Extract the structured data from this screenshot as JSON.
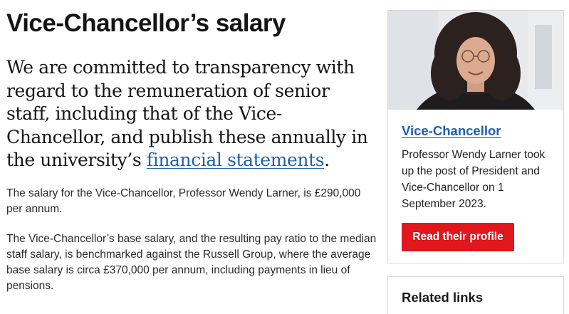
{
  "page": {
    "title": "Vice-Chancellor’s salary",
    "lede_before_link": "We are committed to transparency with regard to the remuneration of senior staff, including that of the Vice-Chancellor, and publish these annually in the university’s ",
    "lede_link": "financial statements",
    "lede_after_link": ".",
    "paragraph_1": "The salary for the Vice-Chancellor, Professor Wendy Larner, is £290,000 per annum.",
    "paragraph_2": "The Vice-Chancellor’s base salary, and the resulting pay ratio to the median staff salary, is benchmarked against the Russell Group, where the average base salary is circa £370,000 per annum, including payments in lieu of pensions."
  },
  "profile_card": {
    "title": "Vice-Chancellor",
    "text": "Professor Wendy Larner took up the post of President and Vice-Chancellor on 1 September 2023.",
    "button_label": "Read their profile"
  },
  "related_links": {
    "heading": "Related links"
  },
  "colors": {
    "link": "#1f5fae",
    "button": "#e0171d",
    "border": "#d9d9d9"
  }
}
